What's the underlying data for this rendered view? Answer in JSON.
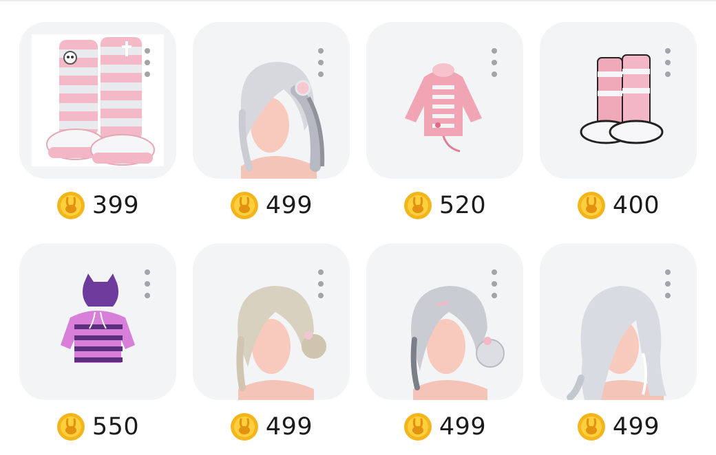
{
  "colors": {
    "card_bg": "#f3f4f6",
    "coin": "#f2b51c",
    "price_text": "#1b1b1b",
    "more_dots": "#a2a4a8"
  },
  "icons": {
    "coin": "bunny-coin-icon",
    "more": "more-vertical-icon"
  },
  "items": [
    {
      "name": "pink striped boots",
      "price": "399"
    },
    {
      "name": "silver side ponytail hair",
      "price": "499"
    },
    {
      "name": "pink striped cat hoodie",
      "price": "520"
    },
    {
      "name": "pink leg warmer sneakers",
      "price": "400"
    },
    {
      "name": "purple striped cat hoodie",
      "price": "550"
    },
    {
      "name": "blonde double bun hair",
      "price": "499"
    },
    {
      "name": "silver low bun hair",
      "price": "499"
    },
    {
      "name": "silver long wavy hair",
      "price": "499"
    }
  ]
}
